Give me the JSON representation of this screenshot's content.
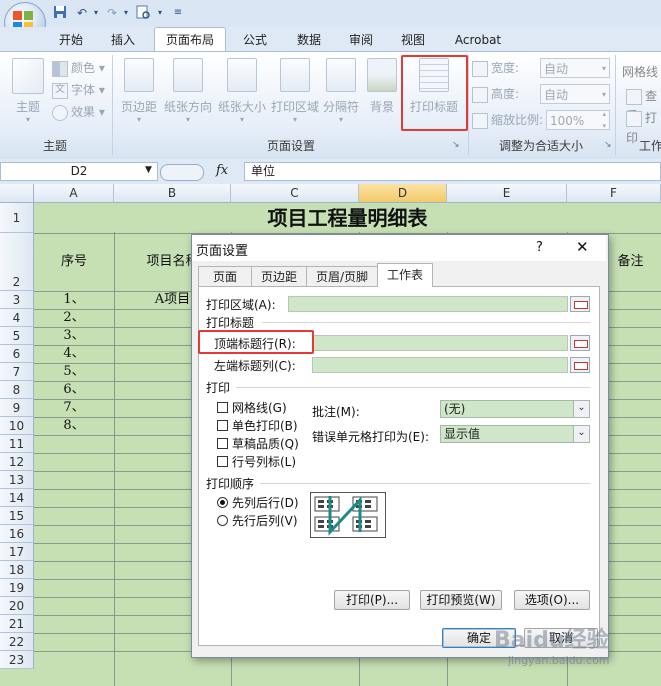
{
  "quick_access": {
    "undo_icon": "undo-icon",
    "redo_icon": "redo-icon"
  },
  "ribbon_tabs": [
    "开始",
    "插入",
    "页面布局",
    "公式",
    "数据",
    "审阅",
    "视图",
    "Acrobat"
  ],
  "active_tab": "页面布局",
  "ribbon": {
    "theme_group": {
      "label": "主题",
      "themes": "主题",
      "colors": "颜色",
      "fonts": "字体",
      "effects": "效果"
    },
    "page_setup_group": {
      "label": "页面设置",
      "margins": "页边距",
      "orientation": "纸张方向",
      "size": "纸张大小",
      "print_area": "打印区域",
      "breaks": "分隔符",
      "background": "背景",
      "print_titles": "打印标题"
    },
    "scale_group": {
      "label": "调整为合适大小",
      "width_label": "宽度:",
      "width_value": "自动",
      "height_label": "高度:",
      "height_value": "自动",
      "scale_label": "缩放比例:",
      "scale_value": "100%"
    },
    "sheet_options_group": {
      "gridlines": "网格线",
      "view": "查看",
      "print": "打印",
      "label": "工作"
    }
  },
  "formula_bar": {
    "name_box": "D2",
    "fx": "fx",
    "content": "单位"
  },
  "columns": [
    "A",
    "B",
    "C",
    "D",
    "E",
    "F"
  ],
  "rows": [
    "1",
    "2",
    "3",
    "4",
    "5",
    "6",
    "7",
    "8",
    "9",
    "10",
    "11",
    "12",
    "13",
    "14",
    "15",
    "16",
    "17",
    "18",
    "19",
    "20",
    "21",
    "22",
    "23"
  ],
  "sheet": {
    "title": "项目工程量明细表",
    "header_seq": "序号",
    "header_name": "项目名称",
    "header_note": "备注",
    "seq_values": [
      "1、",
      "2、",
      "3、",
      "4、",
      "5、",
      "6、",
      "7、",
      "8、"
    ],
    "b3": "A项目"
  },
  "dialog": {
    "title": "页面设置",
    "help": "?",
    "close": "✕",
    "tabs": [
      "页面",
      "页边距",
      "页眉/页脚",
      "工作表"
    ],
    "active_tab": "工作表",
    "print_area_label": "打印区域(A):",
    "print_titles_section": "打印标题",
    "rows_to_repeat_label": "顶端标题行(R):",
    "cols_to_repeat_label": "左端标题列(C):",
    "print_section": "打印",
    "checkboxes": [
      "网格线(G)",
      "单色打印(B)",
      "草稿品质(Q)",
      "行号列标(L)"
    ],
    "comments_label": "批注(M):",
    "comments_value": "(无)",
    "errors_label": "错误单元格打印为(E):",
    "errors_value": "显示值",
    "order_section": "打印顺序",
    "order_options": [
      "先列后行(D)",
      "先行后列(V)"
    ],
    "order_selected": 0,
    "buttons": {
      "print": "打印(P)...",
      "preview": "打印预览(W)",
      "options": "选项(O)...",
      "ok": "确定",
      "cancel": "取消"
    }
  },
  "watermark": {
    "main": "Baidu经验",
    "sub": "jingyan.baidu.com"
  },
  "colors": {
    "accent_red": "#e53935",
    "cell_green": "#c6e0b4",
    "field_green": "#cfe6c9"
  }
}
